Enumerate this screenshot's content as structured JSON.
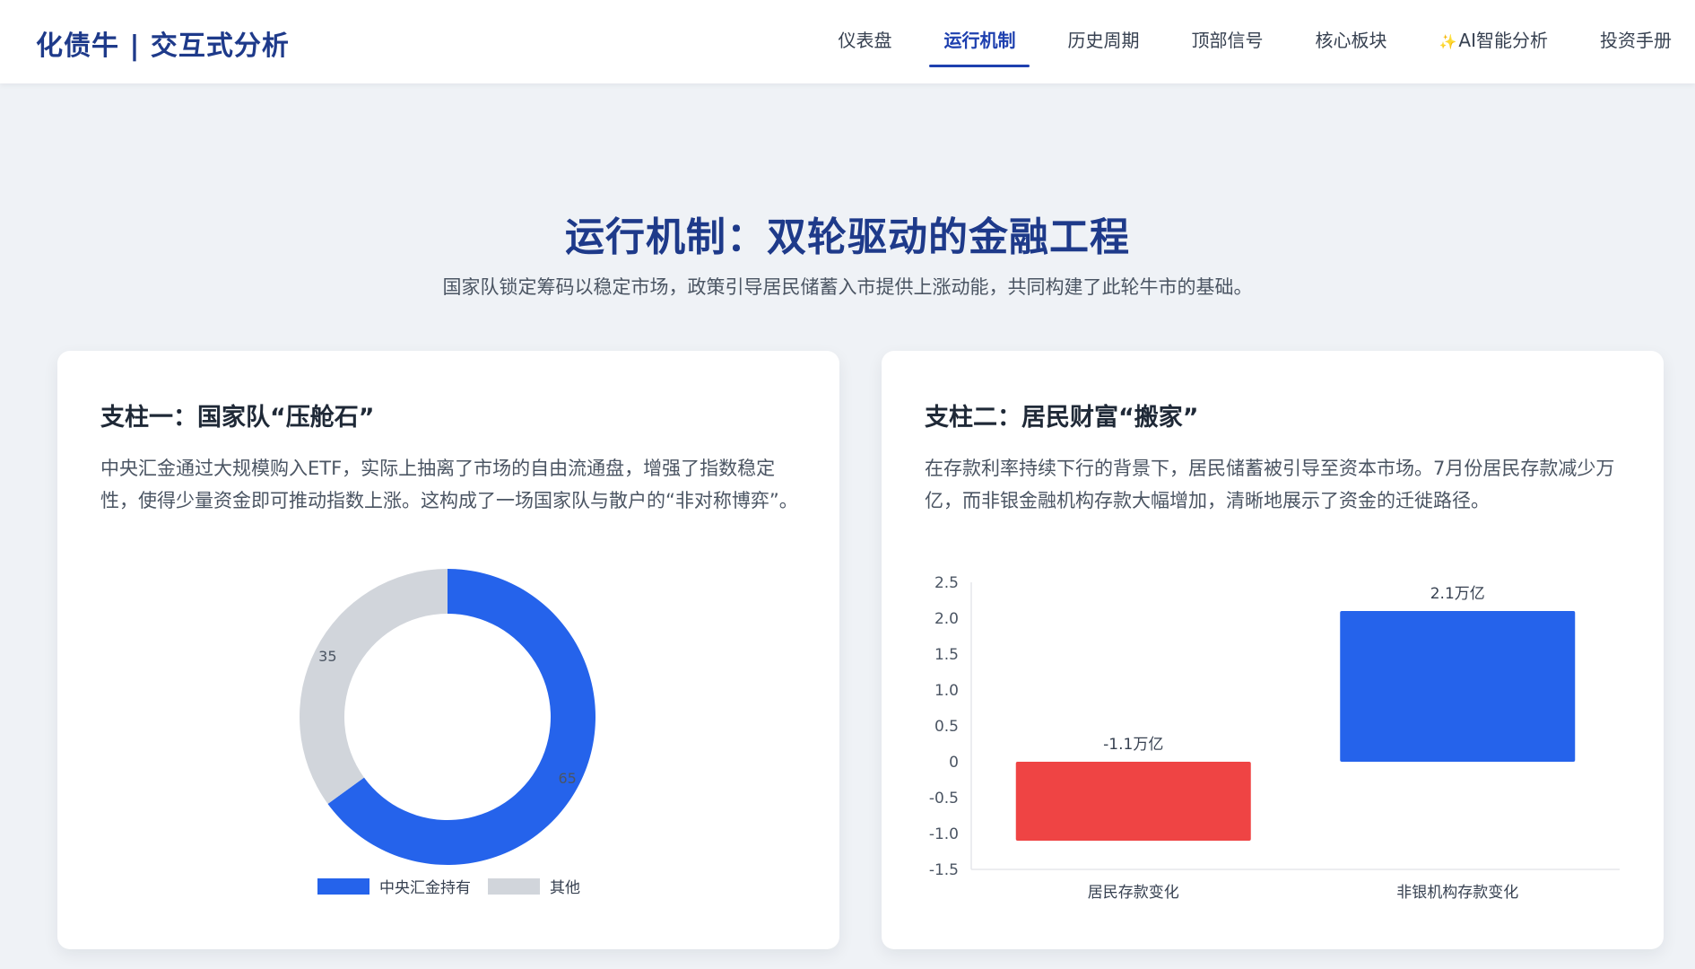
{
  "brand": "化债牛 | 交互式分析",
  "nav": [
    {
      "label": "仪表盘",
      "active": false
    },
    {
      "label": "运行机制",
      "active": true
    },
    {
      "label": "历史周期",
      "active": false
    },
    {
      "label": "顶部信号",
      "active": false
    },
    {
      "label": "核心板块",
      "active": false
    },
    {
      "label": "AI智能分析",
      "active": false,
      "icon": "sparkle-icon"
    },
    {
      "label": "投资手册",
      "active": false
    }
  ],
  "hero": {
    "title": "运行机制：双轮驱动的金融工程",
    "subtitle": "国家队锁定筹码以稳定市场，政策引导居民储蓄入市提供上涨动能，共同构建了此轮牛市的基础。"
  },
  "pillar1": {
    "title": "支柱一：国家队“压舱石”",
    "text": "中央汇金通过大规模购入ETF，实际上抽离了市场的自由流通盘，增强了指数稳定性，使得少量资金即可推动指数上涨。这构成了一场国家队与散户的“非对称博弈”。"
  },
  "pillar2": {
    "title": "支柱二：居民财富“搬家”",
    "text": "在存款利率持续下行的背景下，居民储蓄被引导至资本市场。7月份居民存款减少万亿，而非银金融机构存款大幅增加，清晰地展示了资金的迁徙路径。"
  },
  "colors": {
    "primary": "#2563eb",
    "negative": "#ef4444",
    "other": "#d1d5db",
    "brand": "#1e3a8a"
  },
  "chart_data": [
    {
      "type": "pie",
      "variant": "doughnut",
      "categories": [
        "中央汇金持有",
        "其他"
      ],
      "values": [
        65,
        35
      ],
      "value_labels": [
        "65",
        "35"
      ],
      "legend": "bottom"
    },
    {
      "type": "bar",
      "categories": [
        "居民存款变化",
        "非银机构存款变化"
      ],
      "values": [
        -1.1,
        2.1
      ],
      "data_labels": [
        "-1.1万亿",
        "2.1万亿"
      ],
      "ylim": [
        -1.5,
        2.5
      ],
      "yticks": [
        "2.5",
        "2.0",
        "1.5",
        "1.0",
        "0.5",
        "0",
        "-0.5",
        "-1.0",
        "-1.5"
      ],
      "legend": "none"
    }
  ]
}
